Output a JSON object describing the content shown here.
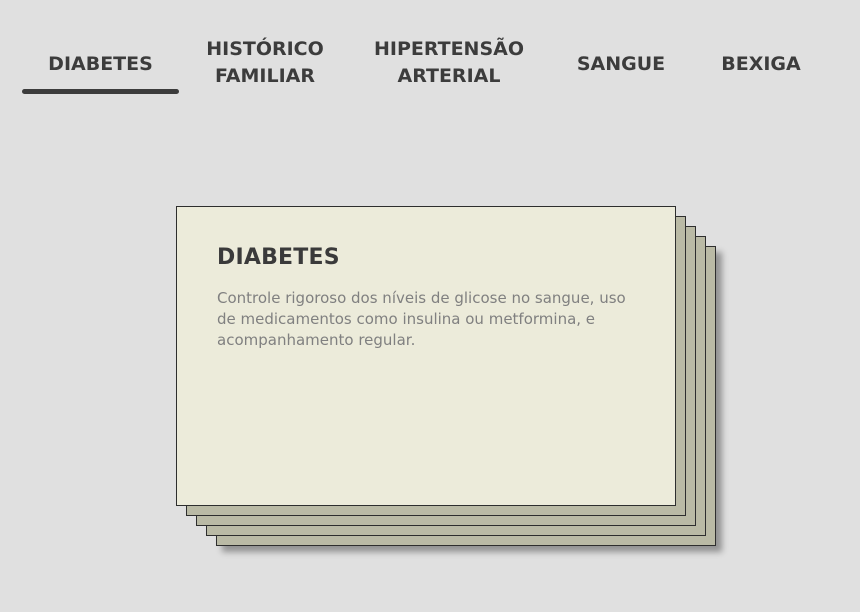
{
  "tabs": [
    {
      "label": "DIABETES",
      "active": true
    },
    {
      "label": "HISTÓRICO\nFAMILIAR",
      "active": false
    },
    {
      "label": "HIPERTENSÃO\nARTERIAL",
      "active": false
    },
    {
      "label": "SANGUE",
      "active": false
    },
    {
      "label": "BEXIGA",
      "active": false
    }
  ],
  "card": {
    "title": "DIABETES",
    "text": "Controle rigoroso dos níveis de glicose no sangue, uso de medicamentos como insulina ou metformina, e acompanhamento regular."
  },
  "colors": {
    "background": "#e0e0e0",
    "card_front": "#ecebda",
    "card_back": "#babaa5",
    "text_dark": "#3c3c3c"
  }
}
